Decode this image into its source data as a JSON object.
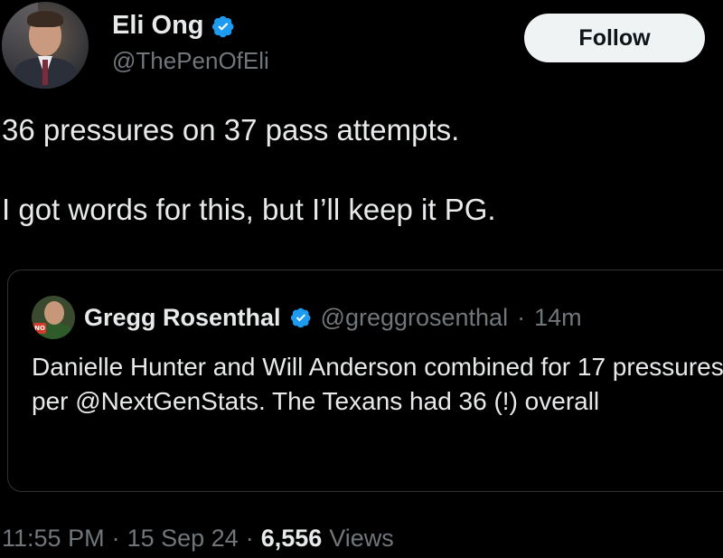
{
  "author": {
    "name": "Eli Ong",
    "handle": "@ThePenOfEli",
    "verified_icon": "verified-badge-icon"
  },
  "follow_button": {
    "label": "Follow"
  },
  "tweet": {
    "lines": [
      "36 pressures on 37 pass attempts.",
      "I got words for this, but I’ll keep it PG."
    ]
  },
  "quoted": {
    "name": "Gregg Rosenthal",
    "handle": "@greggrosenthal",
    "separator": "·",
    "time": "14m",
    "avatar_sign": "NO",
    "text": "Danielle Hunter and Will Anderson combined for 17 pressures per @NextGenStats. The Texans had 36 (!) overall"
  },
  "meta": {
    "time": "11:55 PM",
    "sep1": "·",
    "date": "15 Sep 24",
    "sep2": "·",
    "views_count": "6,556",
    "views_label": "Views"
  },
  "colors": {
    "background": "#000000",
    "text": "#e7e9ea",
    "muted": "#71767b",
    "verified": "#1d9bf0",
    "button_bg": "#eff3f4"
  }
}
